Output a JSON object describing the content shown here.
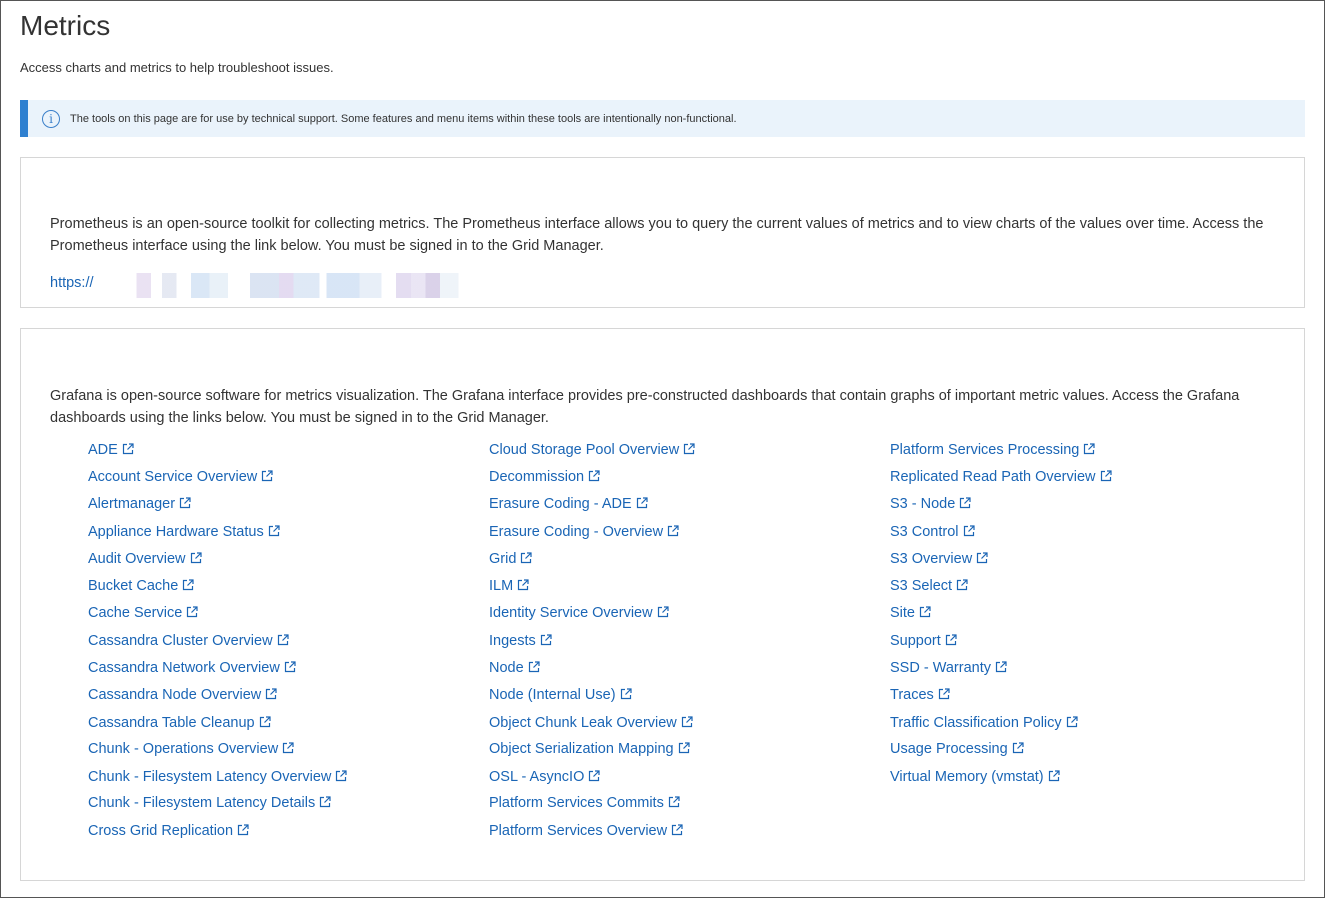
{
  "page": {
    "title": "Metrics",
    "subtitle": "Access charts and metrics to help troubleshoot issues."
  },
  "banner": {
    "icon": "info-icon",
    "text": "The tools on this page are for use by technical support. Some features and menu items within these tools are intentionally non-functional."
  },
  "prometheus": {
    "description": "Prometheus is an open-source toolkit for collecting metrics. The Prometheus interface allows you to query the current values of metrics and to view charts of the values over time. Access the Prometheus interface using the link below. You must be signed in to the Grid Manager.",
    "link_prefix": "https://"
  },
  "grafana": {
    "description": "Grafana is open-source software for metrics visualization. The Grafana interface provides pre-constructed dashboards that contain graphs of important metric values. Access the Grafana dashboards using the links below. You must be signed in to the Grid Manager.",
    "columns": [
      [
        "ADE",
        "Account Service Overview",
        "Alertmanager",
        "Appliance Hardware Status",
        "Audit Overview",
        "Bucket Cache",
        "Cache Service",
        "Cassandra Cluster Overview",
        "Cassandra Network Overview",
        "Cassandra Node Overview",
        "Cassandra Table Cleanup",
        "Chunk - Operations Overview",
        "Chunk - Filesystem Latency Overview",
        "Chunk - Filesystem Latency Details",
        "Cross Grid Replication"
      ],
      [
        "Cloud Storage Pool Overview",
        "Decommission",
        "Erasure Coding - ADE",
        "Erasure Coding - Overview",
        "Grid",
        "ILM",
        "Identity Service Overview",
        "Ingests",
        "Node",
        "Node (Internal Use)",
        "Object Chunk Leak Overview",
        "Object Serialization Mapping",
        "OSL - AsyncIO",
        "Platform Services Commits",
        "Platform Services Overview"
      ],
      [
        "Platform Services Processing",
        "Replicated Read Path Overview",
        "S3 - Node",
        "S3 Control",
        "S3 Overview",
        "S3 Select",
        "Site",
        "Support",
        "SSD - Warranty",
        "Traces",
        "Traffic Classification Policy",
        "Usage Processing",
        "Virtual Memory (vmstat)"
      ]
    ]
  },
  "colors": {
    "link": "#1a65b5",
    "banner_bg": "#eaf3fb",
    "banner_accent": "#2f80d0"
  }
}
